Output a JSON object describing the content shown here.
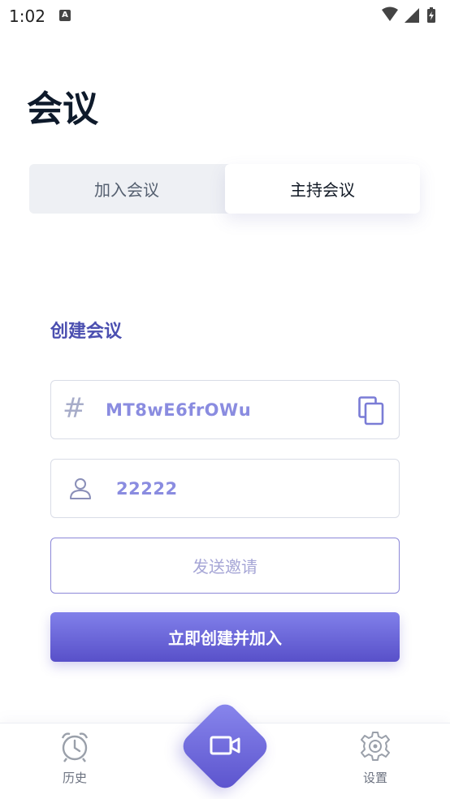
{
  "status_bar": {
    "time": "1:02",
    "notification_badge": "A",
    "icons": [
      "wifi-icon",
      "signal-icon",
      "battery-charging-icon"
    ]
  },
  "page": {
    "title": "会议"
  },
  "tabs": [
    {
      "label": "加入会议",
      "selected": false
    },
    {
      "label": "主持会议",
      "selected": true
    }
  ],
  "create": {
    "section_title": "创建会议",
    "meeting_id_symbol": "#",
    "meeting_id": "MT8wE6frOWu",
    "user_name": "22222",
    "invite_label": "发送邀请",
    "submit_label": "立即创建并加入"
  },
  "bottom_nav": {
    "history_label": "历史",
    "settings_label": "设置",
    "center_icon": "video-camera-icon"
  },
  "colors": {
    "accent": "#5a52cc",
    "accent_light": "#8a8ce0",
    "title_dark": "#0e1a2b"
  }
}
